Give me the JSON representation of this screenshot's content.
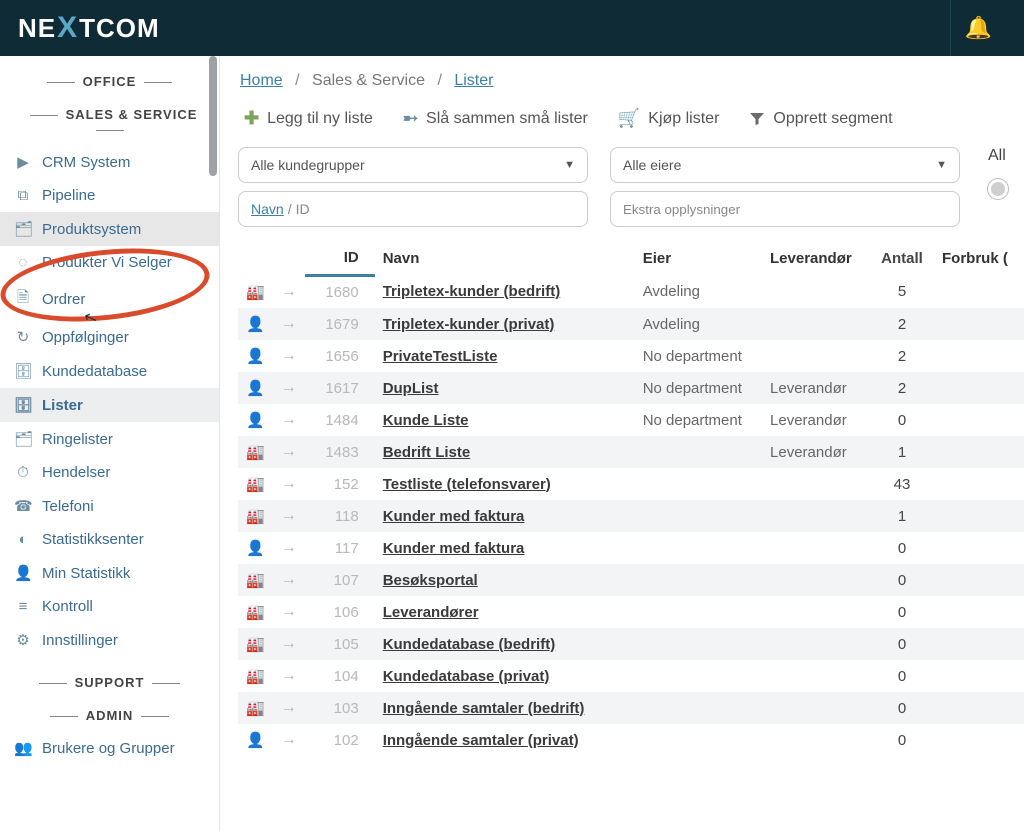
{
  "logo": {
    "pre": "NE",
    "x": "X",
    "post": "TCOM"
  },
  "sidebar": {
    "sections": [
      "OFFICE",
      "SALES & SERVICE",
      "SUPPORT",
      "ADMIN"
    ],
    "items": [
      {
        "label": "CRM System",
        "icon": "▶"
      },
      {
        "label": "Pipeline",
        "icon": "⧉"
      },
      {
        "label": "Produktsystem",
        "icon": "🗂",
        "hl": true
      },
      {
        "label": "Produkter Vi Selger",
        "icon": "◌"
      },
      {
        "label": "Ordrer",
        "icon": "🗎"
      },
      {
        "label": "Oppfølginger",
        "icon": "↻"
      },
      {
        "label": "Kundedatabase",
        "icon": "🗄"
      },
      {
        "label": "Lister",
        "icon": "🗄",
        "active": true
      },
      {
        "label": "Ringelister",
        "icon": "🗂"
      },
      {
        "label": "Hendelser",
        "icon": "⏱"
      },
      {
        "label": "Telefoni",
        "icon": "☎"
      },
      {
        "label": "Statistikksenter",
        "icon": "◐"
      },
      {
        "label": "Min Statistikk",
        "icon": "👤"
      },
      {
        "label": "Kontroll",
        "icon": "≡"
      },
      {
        "label": "Innstillinger",
        "icon": "⚙"
      }
    ],
    "admin_items": [
      {
        "label": "Brukere og Grupper",
        "icon": "👥"
      }
    ]
  },
  "breadcrumb": {
    "home": "Home",
    "mid": "Sales & Service",
    "leaf": "Lister"
  },
  "toolbar": [
    {
      "icon": "✚",
      "cls": "",
      "label": "Legg til ny liste"
    },
    {
      "icon": "➸",
      "cls": "g2",
      "label": "Slå sammen små lister"
    },
    {
      "icon": "🛒",
      "cls": "g3",
      "label": "Kjøp lister"
    },
    {
      "icon": "▾",
      "cls": "g4",
      "label": "Opprett segment",
      "funnel": true
    }
  ],
  "filters": {
    "sel1": "Alle kundegrupper",
    "sel2": "Alle eiere",
    "navn_label": "Navn",
    "navn_id": "ID",
    "input2_ph": "Ekstra opplysninger",
    "all": "All"
  },
  "columns": {
    "id": "ID",
    "navn": "Navn",
    "eier": "Eier",
    "lev": "Leverandør",
    "antall": "Antall",
    "forbruk": "Forbruk ("
  },
  "rows": [
    {
      "t": "b",
      "id": "1680",
      "name": "Tripletex-kunder (bedrift)",
      "eier": "Avdeling",
      "lev": "",
      "n": "5"
    },
    {
      "t": "p",
      "id": "1679",
      "name": "Tripletex-kunder (privat)",
      "eier": "Avdeling",
      "lev": "",
      "n": "2"
    },
    {
      "t": "p",
      "id": "1656",
      "name": "PrivateTestListe",
      "eier": "No department",
      "lev": "",
      "n": "2"
    },
    {
      "t": "p",
      "id": "1617",
      "name": "DupList",
      "eier": "No department",
      "lev": "Leverandør",
      "n": "2"
    },
    {
      "t": "p",
      "id": "1484",
      "name": "Kunde Liste",
      "eier": "No department",
      "lev": "Leverandør",
      "n": "0"
    },
    {
      "t": "b",
      "id": "1483",
      "name": "Bedrift Liste",
      "eier": "",
      "lev": "Leverandør",
      "n": "1"
    },
    {
      "t": "b",
      "id": "152",
      "name": "Testliste (telefonsvarer)",
      "eier": "",
      "lev": "",
      "n": "43"
    },
    {
      "t": "b",
      "id": "118",
      "name": "Kunder med faktura",
      "eier": "",
      "lev": "",
      "n": "1"
    },
    {
      "t": "p",
      "id": "117",
      "name": "Kunder med faktura",
      "eier": "",
      "lev": "",
      "n": "0"
    },
    {
      "t": "b",
      "id": "107",
      "name": "Besøksportal",
      "eier": "",
      "lev": "",
      "n": "0"
    },
    {
      "t": "b",
      "id": "106",
      "name": "Leverandører",
      "eier": "",
      "lev": "",
      "n": "0"
    },
    {
      "t": "b",
      "id": "105",
      "name": "Kundedatabase (bedrift)",
      "eier": "",
      "lev": "",
      "n": "0"
    },
    {
      "t": "b",
      "id": "104",
      "name": "Kundedatabase (privat)",
      "eier": "",
      "lev": "",
      "n": "0"
    },
    {
      "t": "b",
      "id": "103",
      "name": "Inngående samtaler (bedrift)",
      "eier": "",
      "lev": "",
      "n": "0"
    },
    {
      "t": "p",
      "id": "102",
      "name": "Inngående samtaler (privat)",
      "eier": "",
      "lev": "",
      "n": "0"
    }
  ]
}
